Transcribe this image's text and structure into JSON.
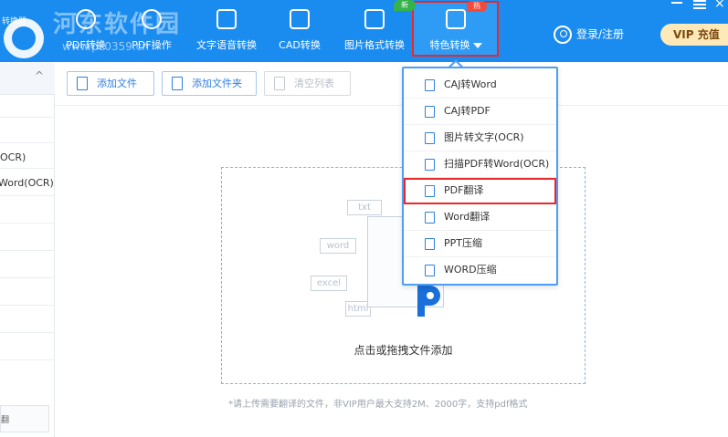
{
  "logo": {
    "small_text": "转换器"
  },
  "watermark": {
    "text": "河东软件园",
    "url": "www.pc0359.cn"
  },
  "nav": {
    "items": [
      {
        "label": "PDF转换"
      },
      {
        "label": "PDF操作"
      },
      {
        "label": "文字语音转换"
      },
      {
        "label": "CAD转换"
      },
      {
        "label": "图片格式转换"
      },
      {
        "label": "特色转换"
      }
    ],
    "badge_new": "新",
    "badge_hot": "热",
    "login": "登录/注册",
    "vip": "VIP 充值"
  },
  "sidebar": {
    "items": [
      {
        "label": "OCR)"
      },
      {
        "label": "Word(OCR)"
      }
    ],
    "bottom_label": "翻"
  },
  "toolbar": {
    "add_file": "添加文件",
    "add_folder": "添加文件夹",
    "clear_list": "清空列表"
  },
  "dropzone": {
    "tags": {
      "txt": "txt",
      "word": "word",
      "excel": "excel",
      "html": "html"
    },
    "text": "点击或拖拽文件添加",
    "footnote": "*请上传需要翻译的文件，非VIP用户最大支持2M、2000字，支持pdf格式"
  },
  "dropdown": {
    "items": [
      {
        "label": "CAJ转Word"
      },
      {
        "label": "CAJ转PDF"
      },
      {
        "label": "图片转文字(OCR)"
      },
      {
        "label": "扫描PDF转Word(OCR)"
      },
      {
        "label": "PDF翻译"
      },
      {
        "label": "Word翻译"
      },
      {
        "label": "PPT压缩"
      },
      {
        "label": "WORD压缩"
      }
    ]
  },
  "colors": {
    "topbar": "#1a8cf0",
    "accent": "#2f80e0",
    "highlight_red": "#e8282b",
    "dropdown_border": "#4d9ef5"
  }
}
